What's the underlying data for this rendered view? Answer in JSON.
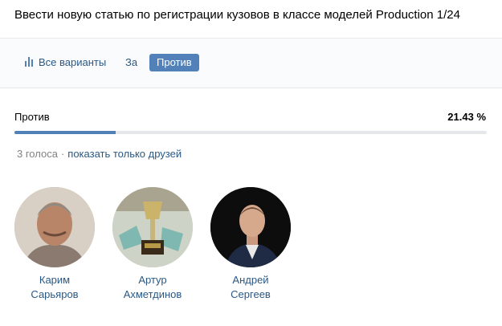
{
  "poll": {
    "title": "Ввести новую статью по регистрации кузовов в классе моделей Production 1/24"
  },
  "tabs": {
    "all": "Все варианты",
    "za": "За",
    "against": "Против"
  },
  "result": {
    "label": "Против",
    "percent_text": "21.43 %",
    "percent_value": 21.43
  },
  "votes": {
    "count_text": "3 голоса",
    "separator": "·",
    "friends_link": "показать только друзей"
  },
  "voters": [
    {
      "first": "Карим",
      "last": "Сарьяров"
    },
    {
      "first": "Артур",
      "last": "Ахметдинов"
    },
    {
      "first": "Андрей",
      "last": "Сергеев"
    }
  ],
  "colors": {
    "accent": "#5181b8",
    "link": "#2a5885",
    "muted": "#828282",
    "track": "#e4e6ea"
  }
}
